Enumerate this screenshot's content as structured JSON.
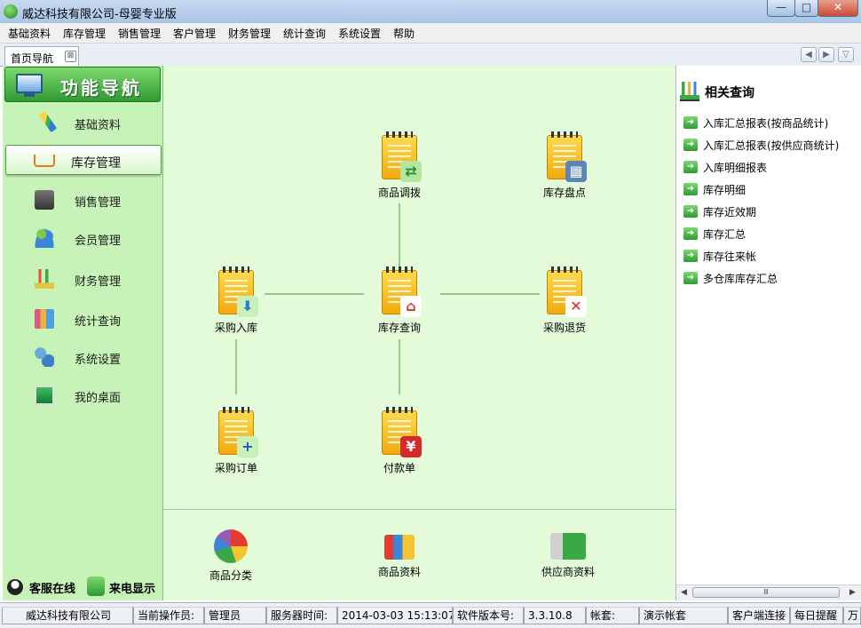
{
  "window": {
    "title": "威达科技有限公司-母婴专业版",
    "min_glyph": "—",
    "max_glyph": "□",
    "close_glyph": "✕"
  },
  "menu": [
    "基础资料",
    "库存管理",
    "销售管理",
    "客户管理",
    "财务管理",
    "统计查询",
    "系统设置",
    "帮助"
  ],
  "tab": {
    "label": "首页导航",
    "close_glyph": "⊠"
  },
  "tab_nav": {
    "prev": "◀",
    "next": "▶",
    "menu": "▽"
  },
  "left_panel": {
    "title": "功能导航",
    "items": [
      {
        "label": "基础资料"
      },
      {
        "label": "库存管理",
        "active": true
      },
      {
        "label": "销售管理"
      },
      {
        "label": "会员管理"
      },
      {
        "label": "财务管理"
      },
      {
        "label": "统计查询"
      },
      {
        "label": "系统设置"
      },
      {
        "label": "我的桌面"
      }
    ],
    "bottom": {
      "qq_label": "客服在线",
      "phone_label": "来电显示"
    }
  },
  "flow": {
    "transfer": "商品调拨",
    "stocktake": "库存盘点",
    "purchase_in": "采购入库",
    "stock_query": "库存查询",
    "purchase_return": "采购退货",
    "purchase_order": "采购订单",
    "payment": "付款单"
  },
  "bottom_items": {
    "category": "商品分类",
    "product": "商品资料",
    "supplier": "供应商资料"
  },
  "right_panel": {
    "title": "相关查询",
    "items": [
      "入库汇总报表(按商品统计)",
      "入库汇总报表(按供应商统计)",
      "入库明细报表",
      "库存明细",
      "库存近效期",
      "库存汇总",
      "库存往来帐",
      "多仓库库存汇总"
    ],
    "scroll": {
      "left": "◀",
      "right": "▶",
      "thumb": "Ⅲ"
    }
  },
  "statusbar": {
    "company": "威达科技有限公司",
    "operator_label": "当前操作员:",
    "operator": "管理员",
    "server_time_label": "服务器时间:",
    "server_time": "2014-03-03 15:13:07",
    "version_label": "软件版本号:",
    "version": "3.3.10.8",
    "account_label": "帐套:",
    "account": "演示帐套",
    "client_status": "客户端连接",
    "daily_reminder": "每日提醒",
    "truncated": "万"
  },
  "colors": {
    "panel_green": "#c7f3b8",
    "center_green": "#e3fbd9",
    "accent_green": "#2f9a34",
    "notepad_yellow": "#f3a90e"
  }
}
